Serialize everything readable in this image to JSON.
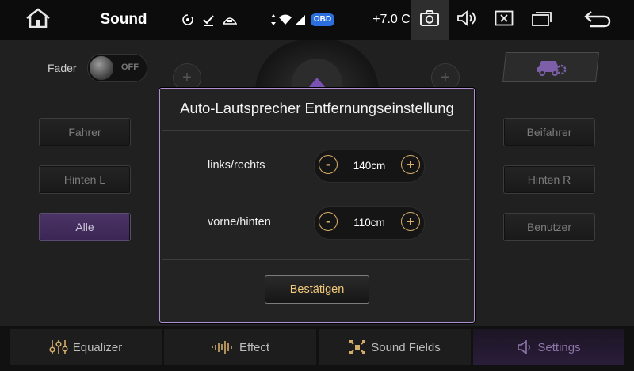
{
  "statusbar": {
    "title": "Sound",
    "obd_label": "OBD",
    "temperature": "+7.0 C",
    "icons": [
      "home-icon",
      "sync-icon",
      "check-download-icon",
      "car-status-icon",
      "data-arrows-icon",
      "wifi-icon",
      "signal-icon",
      "obd-icon",
      "camera-icon",
      "volume-icon",
      "close-box-icon",
      "window-icon",
      "back-icon"
    ]
  },
  "background": {
    "fader_label": "Fader",
    "fader_state": "OFF",
    "left_buttons": [
      "Fahrer",
      "Hinten L",
      "Alle"
    ],
    "right_buttons": [
      "Beifahrer",
      "Hinten R",
      "Benutzer"
    ],
    "active_button": "Alle"
  },
  "dialog": {
    "title": "Auto-Lautsprecher Entfernungseinstellung",
    "rows": [
      {
        "label": "links/rechts",
        "value": "140cm",
        "minus": "-",
        "plus": "+"
      },
      {
        "label": "vorne/hinten",
        "value": "110cm",
        "minus": "-",
        "plus": "+"
      }
    ],
    "confirm_label": "Bestätigen"
  },
  "tabs": [
    {
      "label": "Equalizer",
      "icon": "equalizer-icon"
    },
    {
      "label": "Effect",
      "icon": "waveform-icon"
    },
    {
      "label": "Sound Fields",
      "icon": "sound-fields-icon"
    },
    {
      "label": "Settings",
      "icon": "speaker-icon",
      "active": true
    }
  ],
  "colors": {
    "accent_purple": "#b08fd1",
    "active_tab_text": "#8d76a8",
    "stepper_gold": "#d9b06a",
    "confirm_text": "#f3c97a"
  }
}
